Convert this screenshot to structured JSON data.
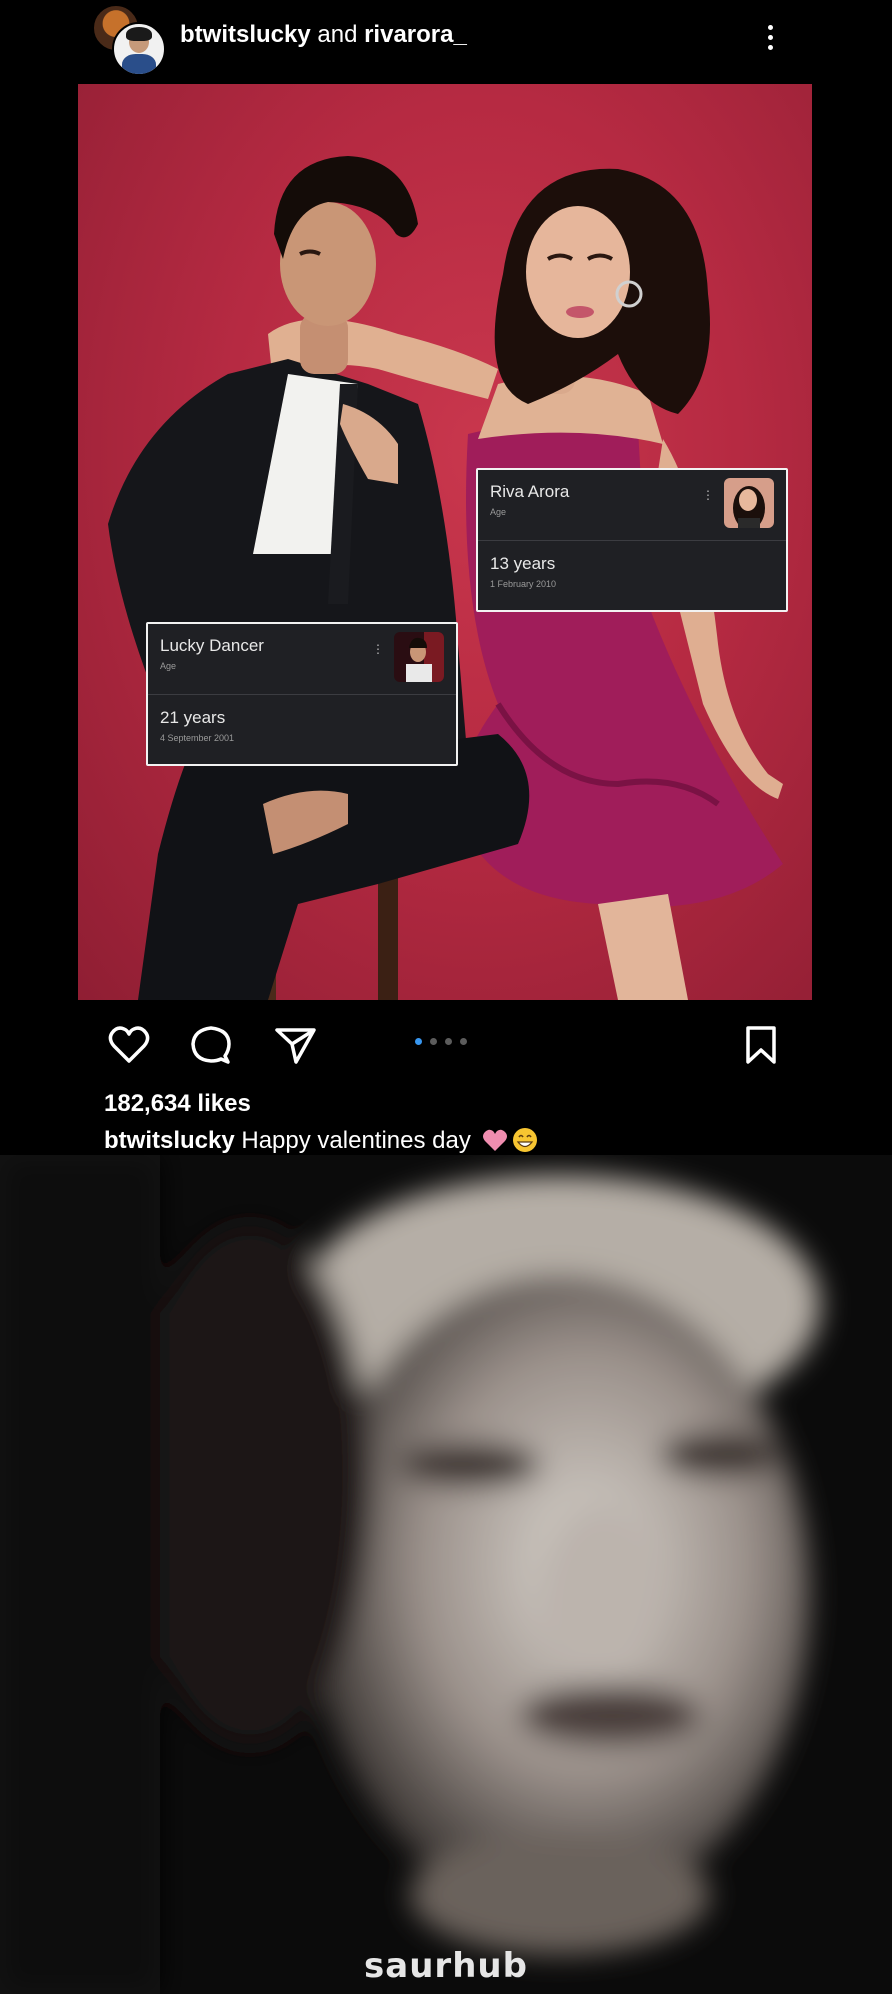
{
  "header": {
    "user_primary": "btwitslucky",
    "joiner": "and",
    "user_secondary": "rivarora_"
  },
  "photo": {
    "background_color": "#b62a42",
    "cards": [
      {
        "name": "Riva Arora",
        "label": "Age",
        "age": "13 years",
        "date": "1 February 2010"
      },
      {
        "name": "Lucky Dancer",
        "label": "Age",
        "age": "21 years",
        "date": "4 September 2001"
      }
    ]
  },
  "carousel": {
    "total": 4,
    "active": 1,
    "active_color": "#3897f0"
  },
  "actions": {
    "like": "heart-icon",
    "comment": "comment-icon",
    "share": "send-icon",
    "save": "bookmark-icon"
  },
  "post": {
    "likes": "182,634 likes",
    "caption_user": "btwitslucky",
    "caption_text": "Happy valentines day",
    "caption_emojis": [
      "pink-heart-emoji",
      "grinning-face-emoji"
    ]
  },
  "meme": {
    "watermark": "saurhub"
  }
}
